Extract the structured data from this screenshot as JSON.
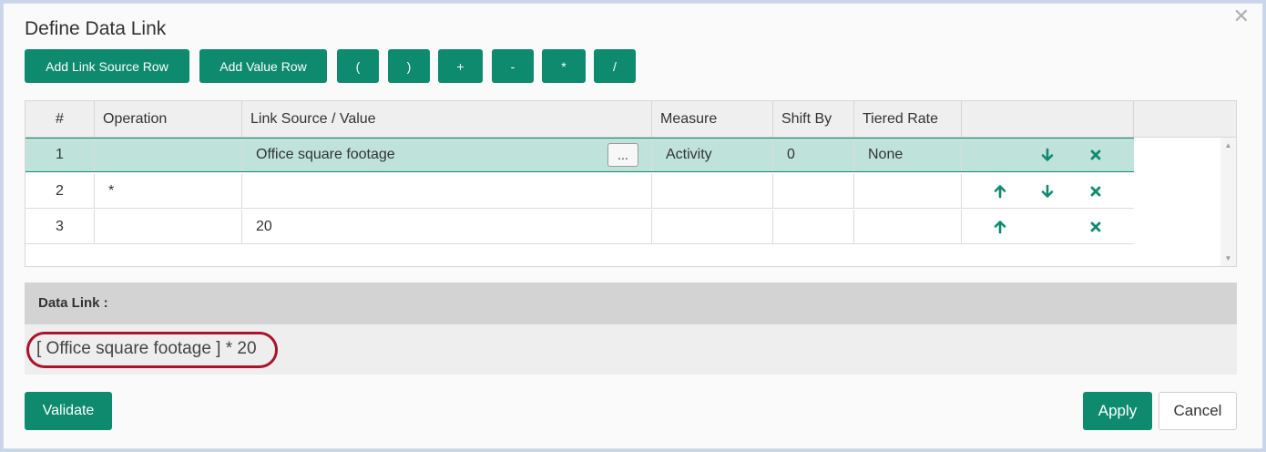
{
  "dialog": {
    "title": "Define Data Link",
    "close_glyph": "✕"
  },
  "toolbar": {
    "add_link_source_row": "Add Link Source Row",
    "add_value_row": "Add Value Row",
    "open_paren": "(",
    "close_paren": ")",
    "plus": "+",
    "minus": "-",
    "multiply": "*",
    "divide": "/"
  },
  "table": {
    "columns": [
      "#",
      "Operation",
      "Link Source / Value",
      "Measure",
      "Shift By",
      "Tiered Rate"
    ],
    "rows": [
      {
        "num": "1",
        "operation": "",
        "source": "Office square footage",
        "measure": "Activity",
        "shift_by": "0",
        "tiered_rate": "None",
        "has_picker": true,
        "up": false,
        "down": true,
        "remove": true,
        "selected": true
      },
      {
        "num": "2",
        "operation": "*",
        "source": "",
        "measure": "",
        "shift_by": "",
        "tiered_rate": "",
        "has_picker": false,
        "up": true,
        "down": true,
        "remove": true,
        "selected": false
      },
      {
        "num": "3",
        "operation": "",
        "source": "20",
        "measure": "",
        "shift_by": "",
        "tiered_rate": "",
        "has_picker": false,
        "up": true,
        "down": false,
        "remove": true,
        "selected": false
      }
    ],
    "picker_label": "...",
    "icons": {
      "up": "arrow-up-icon",
      "down": "arrow-down-icon",
      "remove": "close-icon"
    }
  },
  "data_link": {
    "label": "Data Link :",
    "value": "[ Office square footage ] * 20"
  },
  "footer": {
    "validate": "Validate",
    "apply": "Apply",
    "cancel": "Cancel"
  },
  "colors": {
    "accent": "#0e8a6f",
    "selected_row": "#bfe3da",
    "highlight": "#a8142a"
  }
}
